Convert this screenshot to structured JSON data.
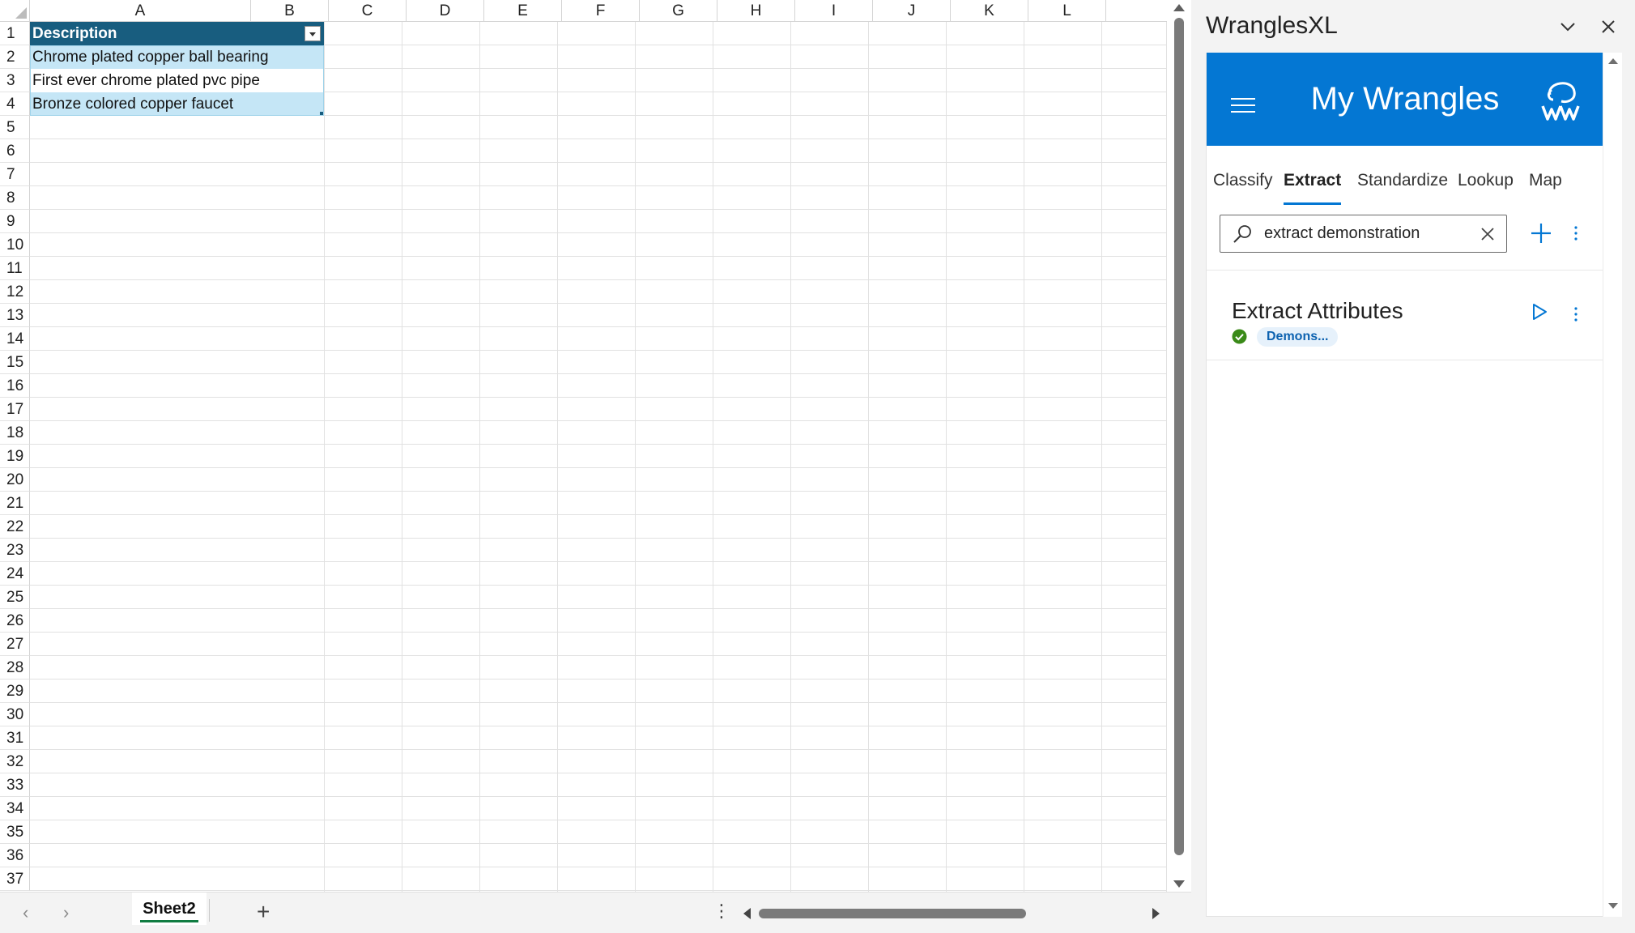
{
  "spreadsheet": {
    "columns": [
      "A",
      "B",
      "C",
      "D",
      "E",
      "F",
      "G",
      "H",
      "I",
      "J",
      "K",
      "L"
    ],
    "rows": [
      "1",
      "2",
      "3",
      "4",
      "5",
      "6",
      "7",
      "8",
      "9",
      "10",
      "11",
      "12",
      "13",
      "14",
      "15",
      "16",
      "17",
      "18",
      "19",
      "20",
      "21",
      "22",
      "23",
      "24",
      "25",
      "26",
      "27",
      "28",
      "29",
      "30",
      "31",
      "32",
      "33",
      "34",
      "35",
      "36",
      "37"
    ],
    "table": {
      "header": "Description",
      "cells": [
        "Chrome plated copper ball bearing",
        "First ever chrome plated pvc pipe",
        "Bronze colored copper faucet"
      ]
    },
    "colors": {
      "table_header": "#185d7f",
      "table_band": "#c5e6f6",
      "active_tab_underline": "#107c41"
    }
  },
  "tabbar": {
    "prev_icon": "‹",
    "next_icon": "›",
    "sheet_tab": "Sheet2",
    "add_sheet_icon": "+",
    "more_icon": "⋮"
  },
  "taskpane": {
    "title": "WranglesXL",
    "banner_title": "My Wrangles",
    "tabs": [
      "Classify",
      "Extract",
      "Standardize",
      "Lookup",
      "Map"
    ],
    "active_tab": "Extract",
    "search": {
      "value": "extract demonstration"
    },
    "card": {
      "title": "Extract Attributes",
      "tag": "Demons..."
    },
    "colors": {
      "brand": "#0477d3",
      "status_ok": "#3a8a18",
      "tag_bg": "#e6f1fb"
    }
  }
}
